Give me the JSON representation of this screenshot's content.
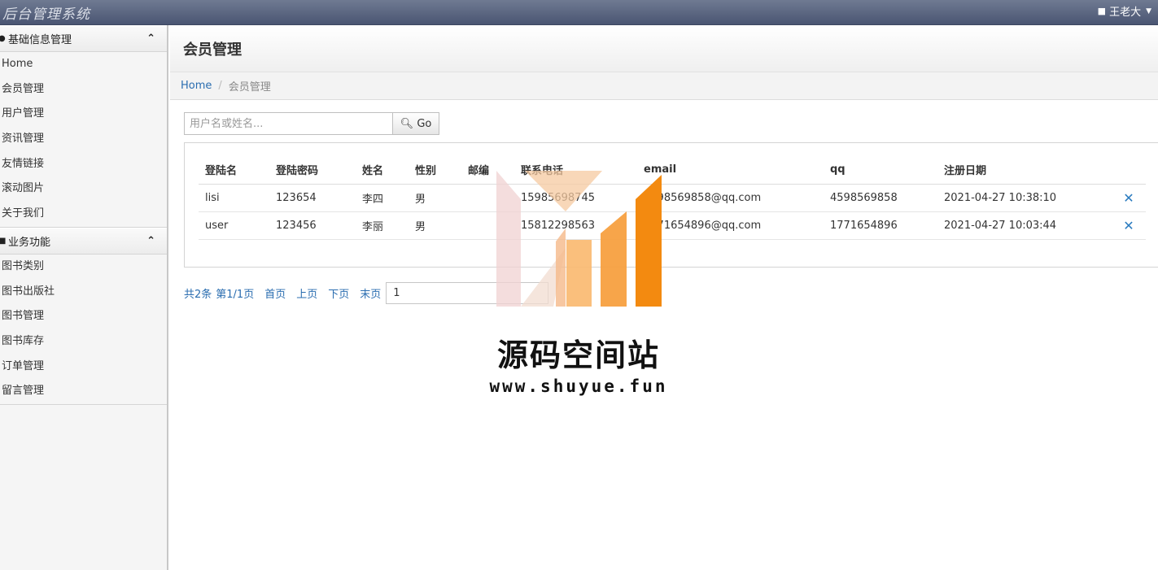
{
  "header": {
    "brand": "后台管理系统",
    "user_name": "王老大"
  },
  "sidebar": {
    "sections": [
      {
        "title": "基础信息管理",
        "items": [
          "Home",
          "会员管理",
          "用户管理",
          "资讯管理",
          "友情链接",
          "滚动图片",
          "关于我们"
        ]
      },
      {
        "title": "业务功能",
        "items": [
          "图书类别",
          "图书出版社",
          "图书管理",
          "图书库存",
          "订单管理",
          "留言管理"
        ]
      }
    ]
  },
  "page": {
    "title": "会员管理",
    "breadcrumb": {
      "home": "Home",
      "current": "会员管理"
    },
    "search": {
      "placeholder": "用户名或姓名...",
      "button": "Go"
    }
  },
  "table": {
    "columns": [
      "登陆名",
      "登陆密码",
      "姓名",
      "性别",
      "邮编",
      "联系电话",
      "email",
      "qq",
      "注册日期"
    ],
    "rows": [
      {
        "cells": [
          "lisi",
          "123654",
          "李四",
          "男",
          "",
          "15985698745",
          "4598569858@qq.com",
          "4598569858",
          "2021-04-27 10:38:10"
        ]
      },
      {
        "cells": [
          "user",
          "123456",
          "李丽",
          "男",
          "",
          "15812298563",
          "1771654896@qq.com",
          "1771654896",
          "2021-04-27 10:03:44"
        ]
      }
    ],
    "delete_glyph": "✕"
  },
  "pager": {
    "total": "共2条",
    "page": "第1/1页",
    "first": "首页",
    "prev": "上页",
    "next": "下页",
    "last": "末页",
    "input_value": "1"
  },
  "watermark": {
    "title": "源码空间站",
    "url": "www.shuyue.fun"
  }
}
